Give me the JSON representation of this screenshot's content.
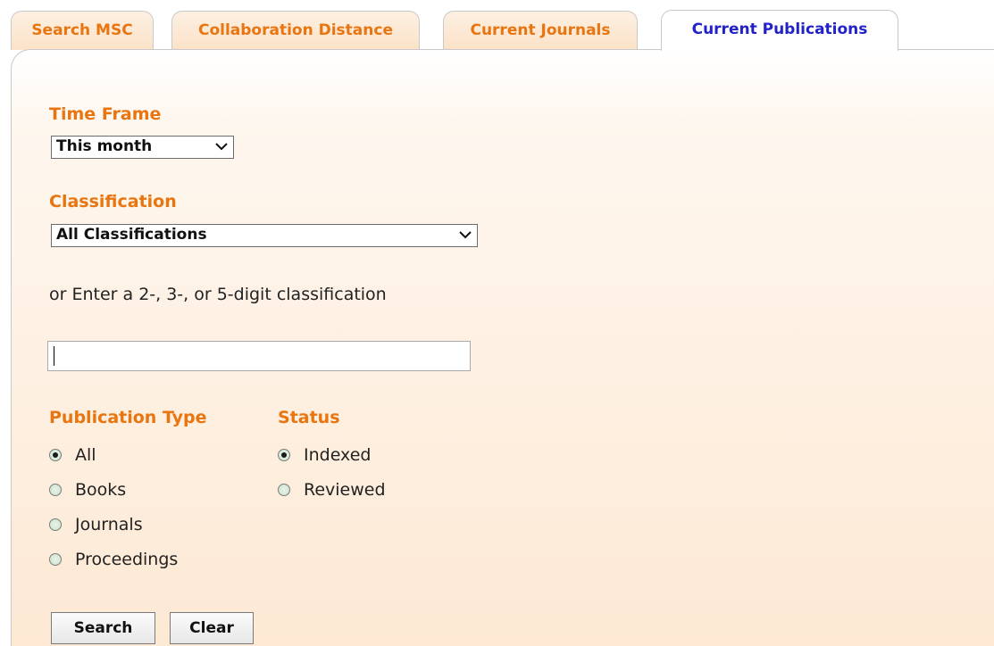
{
  "tabs": [
    {
      "label": "Search MSC",
      "active": false
    },
    {
      "label": "Collaboration Distance",
      "active": false
    },
    {
      "label": "Current Journals",
      "active": false
    },
    {
      "label": "Current Publications",
      "active": true
    }
  ],
  "form": {
    "time_frame": {
      "label": "Time Frame",
      "selected": "This month"
    },
    "classification": {
      "label": "Classification",
      "selected": "All Classifications",
      "hint": "or Enter a 2-, 3-, or 5-digit classification",
      "input_value": ""
    },
    "publication_type": {
      "label": "Publication Type",
      "options": [
        {
          "label": "All",
          "checked": true
        },
        {
          "label": "Books",
          "checked": false
        },
        {
          "label": "Journals",
          "checked": false
        },
        {
          "label": "Proceedings",
          "checked": false
        }
      ]
    },
    "status": {
      "label": "Status",
      "options": [
        {
          "label": "Indexed",
          "checked": true
        },
        {
          "label": "Reviewed",
          "checked": false
        }
      ]
    },
    "buttons": {
      "search": "Search",
      "clear": "Clear"
    }
  },
  "colors": {
    "accent": "#e8750f",
    "active_tab_text": "#2222c8",
    "panel_bottom": "#fde9d4"
  }
}
